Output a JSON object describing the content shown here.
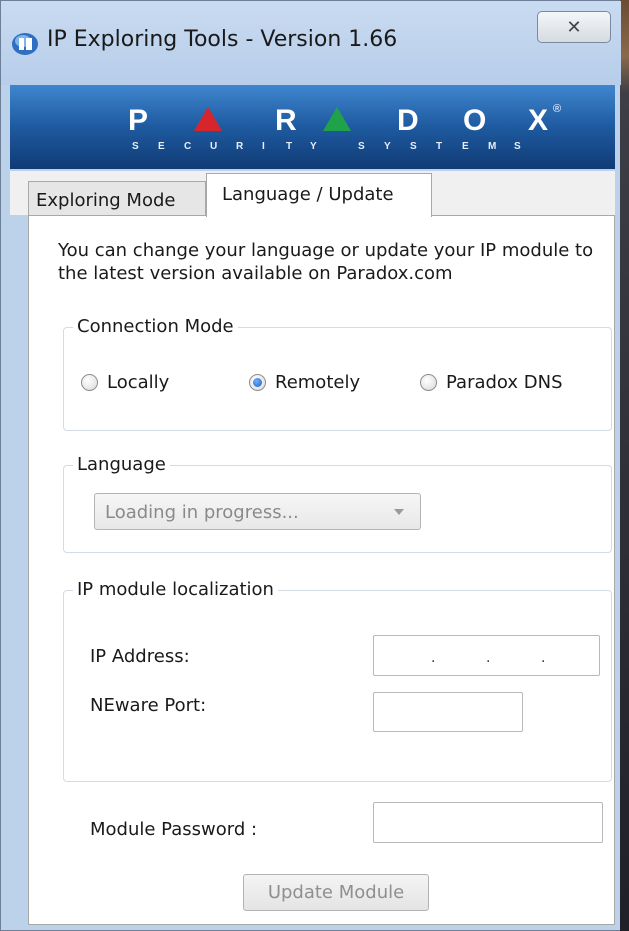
{
  "window": {
    "title": "IP Exploring Tools - Version 1.66",
    "close_glyph": "✕"
  },
  "banner": {
    "brand_letters": [
      "P",
      "R",
      "D",
      "O",
      "X"
    ],
    "brand_registered": "®",
    "tagline_letters": [
      "S",
      "E",
      "C",
      "U",
      "R",
      "I",
      "T",
      "Y",
      "S",
      "Y",
      "S",
      "T",
      "E",
      "M",
      "S"
    ],
    "colors": {
      "background": "#1b4f92",
      "red_triangle": "#d6252b",
      "green_triangle": "#1fa24a"
    }
  },
  "tabs": [
    {
      "label": "Exploring Mode",
      "active": false
    },
    {
      "label": "Language / Update",
      "active": true
    }
  ],
  "intro_text": "You can change your language or update your IP module to the latest version available on Paradox.com",
  "connection_mode": {
    "legend": "Connection Mode",
    "options": [
      {
        "label": "Locally",
        "selected": false
      },
      {
        "label": "Remotely",
        "selected": true
      },
      {
        "label": "Paradox DNS",
        "selected": false
      }
    ]
  },
  "language": {
    "legend": "Language",
    "selected_value": "Loading in progress..."
  },
  "ip_localization": {
    "legend": "IP module localization",
    "ip_address_label": "IP Address:",
    "ip_address_value": ". . .",
    "neware_port_label": "NEware Port:",
    "neware_port_value": ""
  },
  "module_password": {
    "label": "Module Password :",
    "value": ""
  },
  "update_button": {
    "label": "Update Module",
    "enabled": false
  }
}
